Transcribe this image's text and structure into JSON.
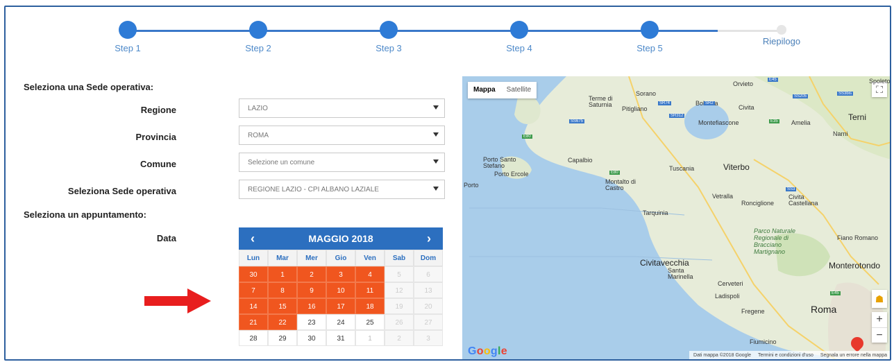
{
  "stepper": {
    "steps": [
      {
        "label": "Step 1",
        "state": "done"
      },
      {
        "label": "Step 2",
        "state": "done"
      },
      {
        "label": "Step 3",
        "state": "done"
      },
      {
        "label": "Step 4",
        "state": "done"
      },
      {
        "label": "Step 5",
        "state": "done"
      },
      {
        "label": "Riepilogo",
        "state": "pending"
      }
    ]
  },
  "form": {
    "section_sede": "Seleziona una Sede operativa:",
    "regione": {
      "label": "Regione",
      "value": "LAZIO"
    },
    "provincia": {
      "label": "Provincia",
      "value": "ROMA"
    },
    "comune": {
      "label": "Comune",
      "placeholder": "Selezione un comune"
    },
    "sede": {
      "label": "Seleziona Sede operativa",
      "value": "REGIONE LAZIO - CPI ALBANO LAZIALE"
    },
    "section_appuntamento": "Seleziona un appuntamento:",
    "data_label": "Data"
  },
  "calendar": {
    "month_label": "MAGGIO 2018",
    "prev": "‹",
    "next": "›",
    "weekdays": [
      "Lun",
      "Mar",
      "Mer",
      "Gio",
      "Ven",
      "Sab",
      "Dom"
    ],
    "weeks": [
      [
        {
          "d": "30",
          "s": "avail"
        },
        {
          "d": "1",
          "s": "avail"
        },
        {
          "d": "2",
          "s": "avail"
        },
        {
          "d": "3",
          "s": "avail"
        },
        {
          "d": "4",
          "s": "avail"
        },
        {
          "d": "5",
          "s": "off"
        },
        {
          "d": "6",
          "s": "off"
        }
      ],
      [
        {
          "d": "7",
          "s": "avail"
        },
        {
          "d": "8",
          "s": "avail"
        },
        {
          "d": "9",
          "s": "avail"
        },
        {
          "d": "10",
          "s": "avail"
        },
        {
          "d": "11",
          "s": "avail"
        },
        {
          "d": "12",
          "s": "off"
        },
        {
          "d": "13",
          "s": "off"
        }
      ],
      [
        {
          "d": "14",
          "s": "avail"
        },
        {
          "d": "15",
          "s": "avail"
        },
        {
          "d": "16",
          "s": "avail"
        },
        {
          "d": "17",
          "s": "avail"
        },
        {
          "d": "18",
          "s": "avail"
        },
        {
          "d": "19",
          "s": "off"
        },
        {
          "d": "20",
          "s": "off"
        }
      ],
      [
        {
          "d": "21",
          "s": "avail"
        },
        {
          "d": "22",
          "s": "avail"
        },
        {
          "d": "23",
          "s": "normal"
        },
        {
          "d": "24",
          "s": "normal"
        },
        {
          "d": "25",
          "s": "normal"
        },
        {
          "d": "26",
          "s": "off"
        },
        {
          "d": "27",
          "s": "off"
        }
      ],
      [
        {
          "d": "28",
          "s": "normal"
        },
        {
          "d": "29",
          "s": "normal"
        },
        {
          "d": "30",
          "s": "normal"
        },
        {
          "d": "31",
          "s": "normal"
        },
        {
          "d": "1",
          "s": "other"
        },
        {
          "d": "2",
          "s": "off"
        },
        {
          "d": "3",
          "s": "off"
        }
      ]
    ]
  },
  "map": {
    "type_map": "Mappa",
    "type_satellite": "Satellite",
    "zoom_in": "+",
    "zoom_out": "−",
    "fullscreen": "⛶",
    "footer_data": "Dati mappa ©2018 Google",
    "footer_terms": "Termini e condizioni d'uso",
    "footer_report": "Segnala un errore nella mappa",
    "places": {
      "orvieto": "Orvieto",
      "sorano": "Sorano",
      "terme": "Terme di Saturnia",
      "pitigliano": "Pitigliano",
      "bolsena": "Bolsena",
      "civita": "Civita",
      "amelia": "Amelia",
      "narni": "Narni",
      "terni": "Terni",
      "montefiascone": "Montefiascone",
      "capalbio": "Capalbio",
      "porto_santo": "Porto Santo Stefano",
      "porto_ercole": "Porto Ercole",
      "porto": "Porto",
      "tuscania": "Tuscania",
      "viterbo": "Viterbo",
      "montalto": "Montalto di Castro",
      "vetralla": "Vetralla",
      "ronciglione": "Ronciglione",
      "civita_castellana": "Civita Castellana",
      "tarquinia": "Tarquinia",
      "parco": "Parco Naturale Regionale di Bracciano Martignano",
      "fiano": "Fiano Romano",
      "civitavecchia": "Civitavecchia",
      "santa_marinella": "Santa Marinella",
      "cerveteri": "Cerveteri",
      "monterotondo": "Monterotondo",
      "ladispoli": "Ladispoli",
      "roma": "Roma",
      "fregene": "Fregene",
      "fiumicino": "Fiumicino",
      "spoleto": "Spoleto"
    },
    "roads": [
      "E45",
      "SR74",
      "SR2",
      "SR312",
      "E80",
      "SS3bis",
      "E35",
      "SS675",
      "SS3",
      "SS205",
      "E80",
      "E45"
    ]
  },
  "colors": {
    "accent": "#2c6fbf",
    "available_day": "#f0561f",
    "arrow": "#e81e1e"
  }
}
